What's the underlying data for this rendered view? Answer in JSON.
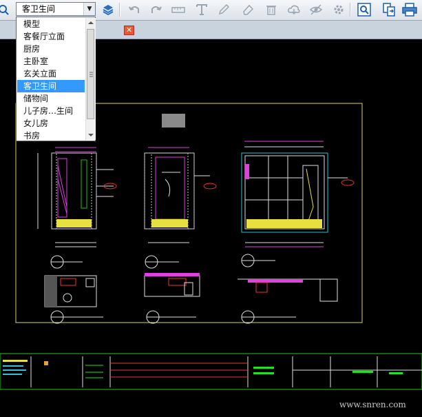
{
  "toolbar": {
    "layer_select_value": "客卫生间",
    "icons": [
      "zoom-icon",
      "layers-icon",
      "undo-icon",
      "redo-icon",
      "measure-icon",
      "text-icon",
      "pen-icon",
      "eraser-icon",
      "delete-icon",
      "cloud-download-icon",
      "hide-icon",
      "settings-icon",
      "zoom-extent-icon",
      "export-icon",
      "print-icon"
    ]
  },
  "dropdown": {
    "items": [
      "模型",
      "客餐厅立面",
      "厨房",
      "主卧室",
      "玄关立面",
      "客卫生间",
      "储物间",
      "儿子房…生间",
      "女儿房",
      "书房"
    ],
    "selected_index": 5
  },
  "watermark": "www.snren.com",
  "colors": {
    "toolbar_bg": "#dde3ea",
    "canvas_bg": "#000000",
    "selection": "#3399ff",
    "tab_close": "#e45a2c"
  }
}
